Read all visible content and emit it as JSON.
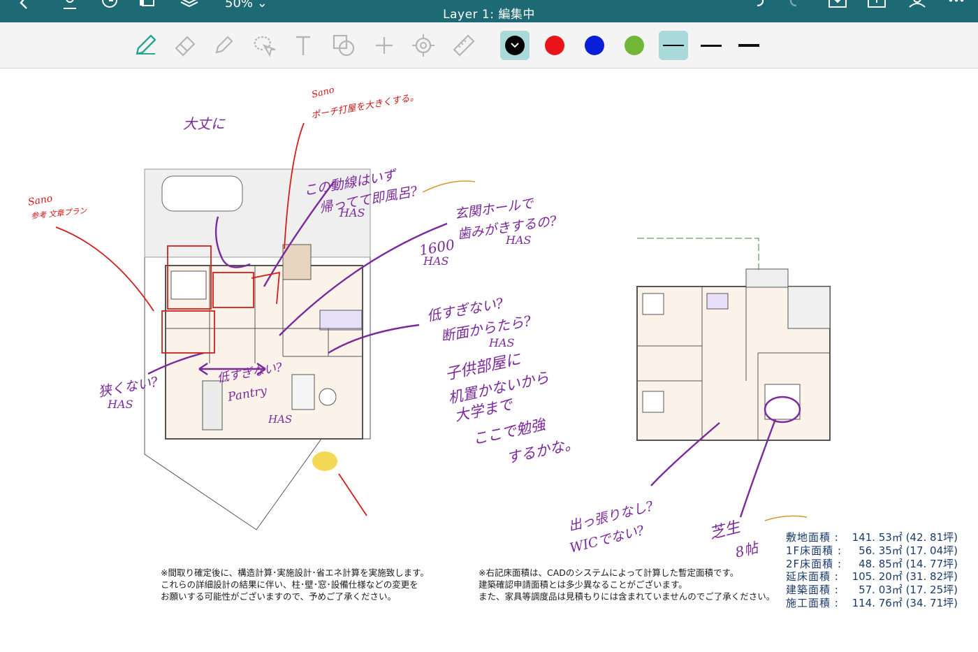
{
  "header": {
    "title": "Layer 1: 編集中",
    "zoom": "50%"
  },
  "toolbar": {
    "tools": [
      "pen-tool-icon",
      "eraser-icon",
      "highlighter-icon",
      "lasso-icon",
      "text-tool-icon",
      "shape-tool-icon",
      "plus-icon",
      "laser-pointer-icon",
      "ruler-icon"
    ],
    "colors": [
      "#000000",
      "#e8141a",
      "#0a1ed8",
      "#73b739"
    ],
    "selected_color": "#000000",
    "accent": "#1e6a74"
  },
  "notes": {
    "left_line1": "※間取り確定後に、構造計算･実施設計･省エネ計算を実施致します。",
    "left_line2": "これらの詳細設計の結果に伴い、柱･壁･窓･設備仕様などの変更を",
    "left_line3": "お願いする可能性がございますので、予めご了承ください。",
    "right_line1": "※右記床面積は、CADのシステムによって計算した暫定面積です。",
    "right_line2": "建築確認申請面積とは多少異なることがございます。",
    "right_line3": "また、家具等調度品は見積もりには含まれていませんのでご了承ください。"
  },
  "areas": [
    {
      "label": "敷地面積 :",
      "value": "141. 53㎡ (42. 81坪)"
    },
    {
      "label": "1F床面積 :",
      "value": "56. 35㎡ (17. 04坪)"
    },
    {
      "label": "2F床面積 :",
      "value": "48. 85㎡ (14. 77坪)"
    },
    {
      "label": "延床面積 :",
      "value": "105. 20㎡ (31. 82坪)"
    },
    {
      "label": "建築面積 :",
      "value": "57. 03㎡ (17. 25坪)"
    },
    {
      "label": "施工面積 :",
      "value": "114. 76㎡ (34. 71坪)"
    }
  ],
  "annotations": {
    "a1": "大丈に",
    "a2": "ポーチ打屋を大きくする。",
    "a3": "この動線はいず",
    "a4": "帰ってて即風呂?",
    "a5": "HAS",
    "a6": "玄関ホールで",
    "a7": "歯みがきするの?",
    "a8": "1600",
    "a9": "低すぎない?",
    "a10": "断面からたら?",
    "a11": "子供部屋に",
    "a12": "机置かないから",
    "a13": "大学まで",
    "a14": "ここで勉強",
    "a15": "するかな。",
    "a16": "狭くない?",
    "a17": "低すぎない?",
    "a18": "Pantry",
    "a19": "出っ張りなし?",
    "a20": "WICでない?",
    "a21": "芝生",
    "a22": "8帖",
    "a23": "Sano",
    "a24": "参考 文章プラン"
  }
}
